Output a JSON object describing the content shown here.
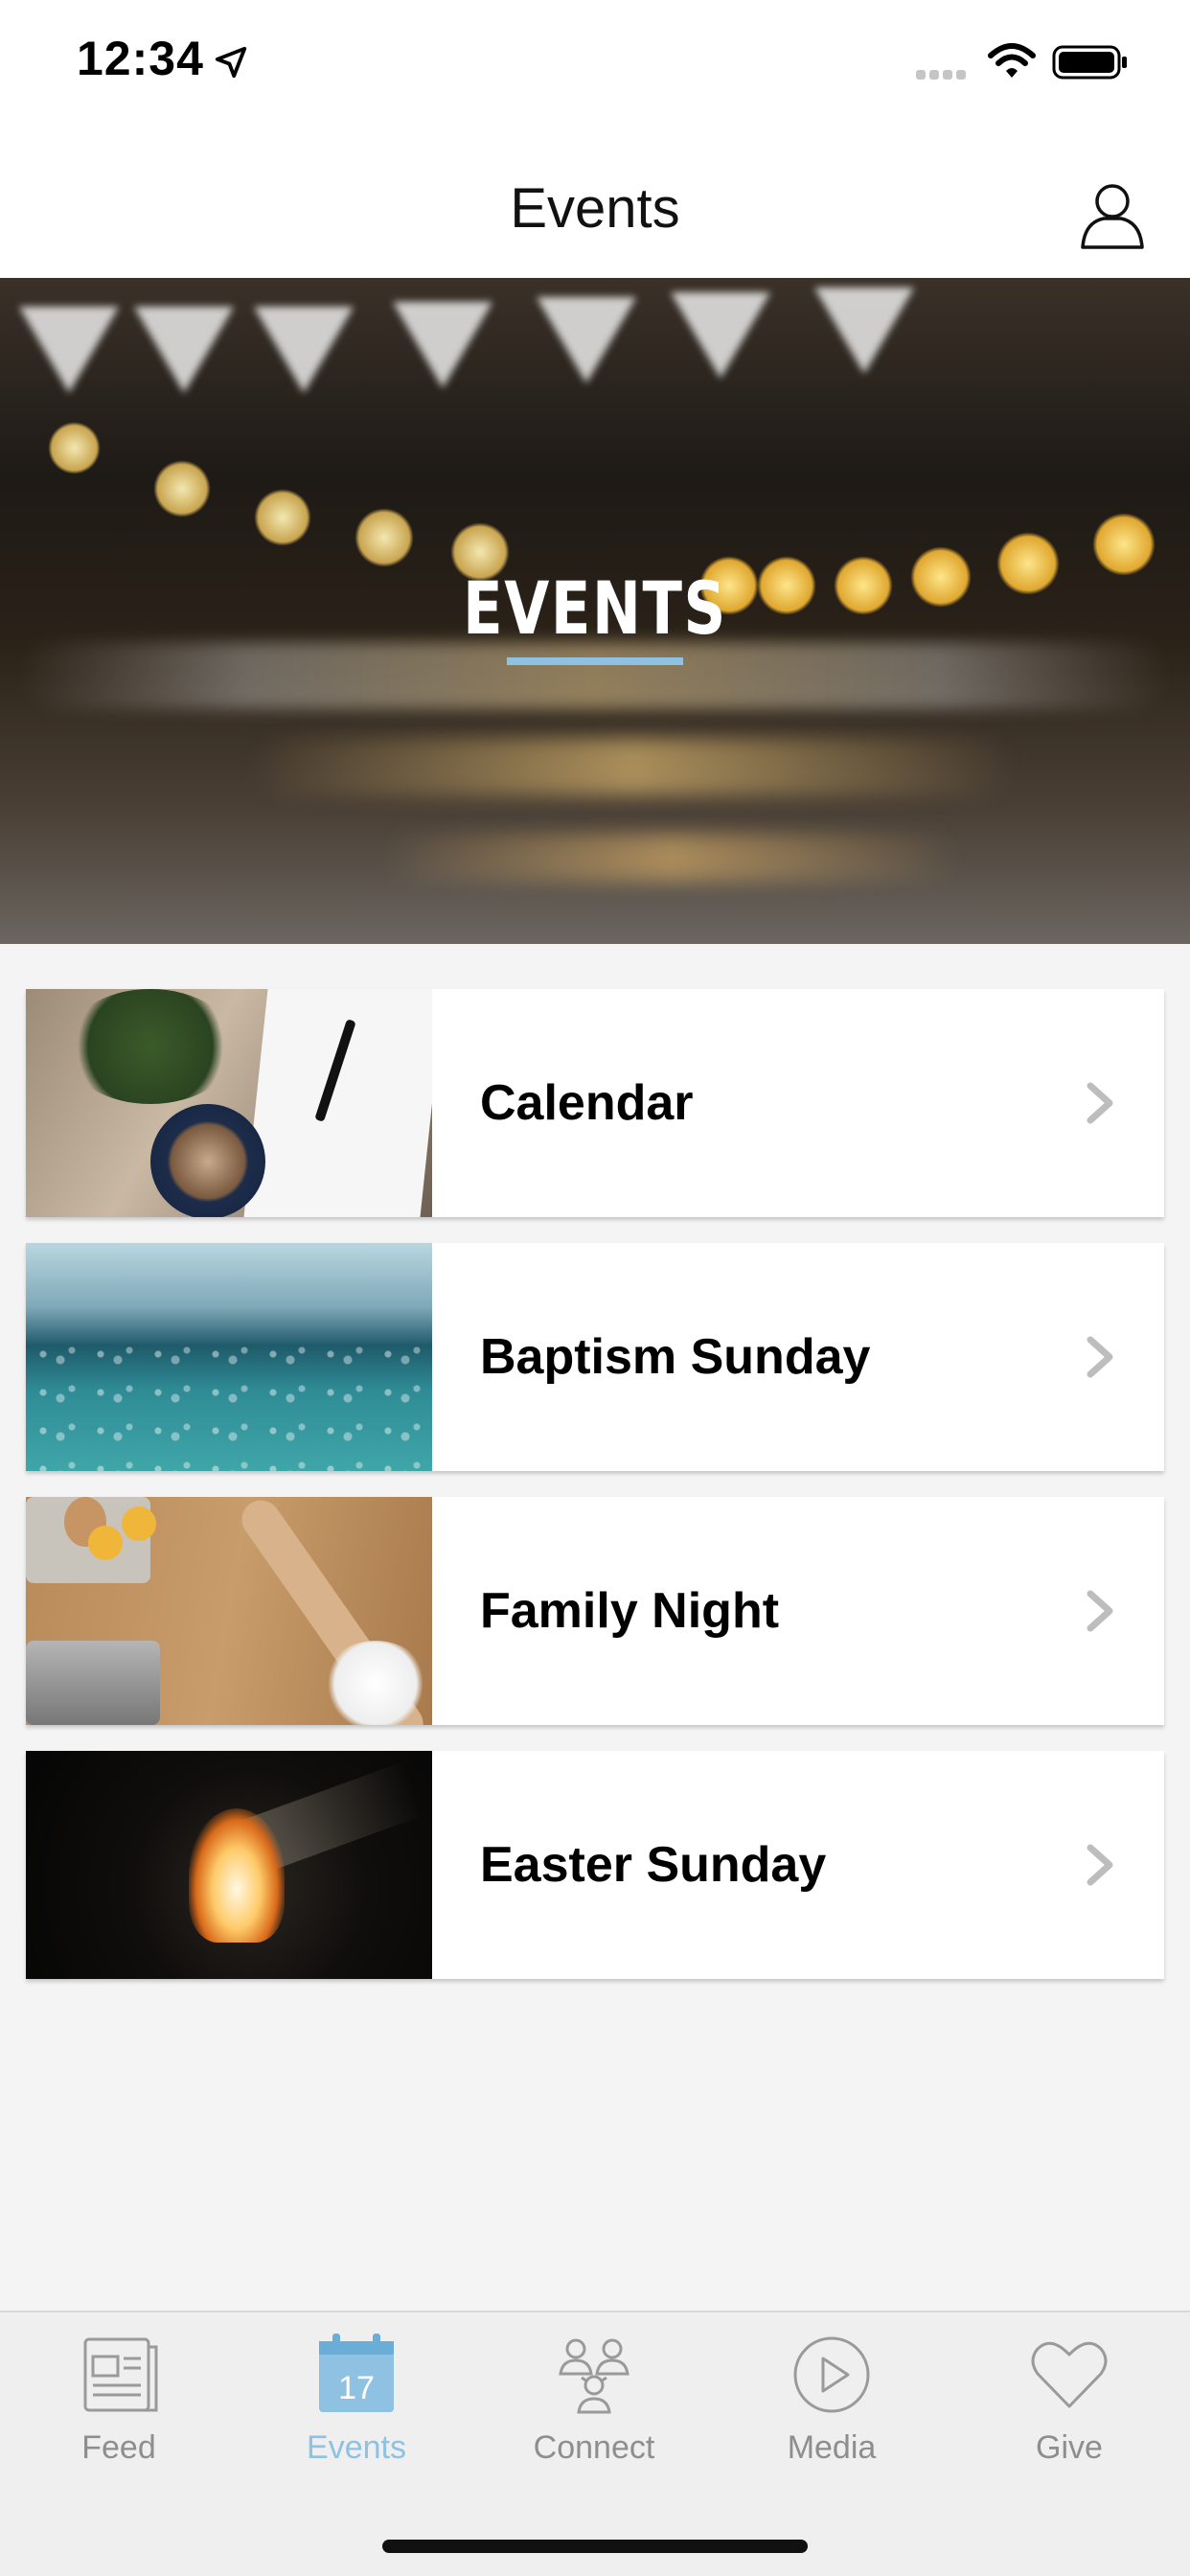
{
  "status_bar": {
    "time": "12:34"
  },
  "header": {
    "title": "Events"
  },
  "hero": {
    "title": "EVENTS"
  },
  "events": [
    {
      "label": "Calendar"
    },
    {
      "label": "Baptism Sunday"
    },
    {
      "label": "Family Night"
    },
    {
      "label": "Easter Sunday"
    }
  ],
  "tab_bar": {
    "tabs": [
      {
        "label": "Feed",
        "icon": "newspaper-icon"
      },
      {
        "label": "Events",
        "icon": "calendar-icon",
        "badge": "17"
      },
      {
        "label": "Connect",
        "icon": "people-icon"
      },
      {
        "label": "Media",
        "icon": "play-icon"
      },
      {
        "label": "Give",
        "icon": "heart-icon"
      }
    ],
    "active_index": 1
  },
  "colors": {
    "accent": "#8fc1e3",
    "inactive": "#8e8e8e",
    "background": "#f4f4f4"
  }
}
